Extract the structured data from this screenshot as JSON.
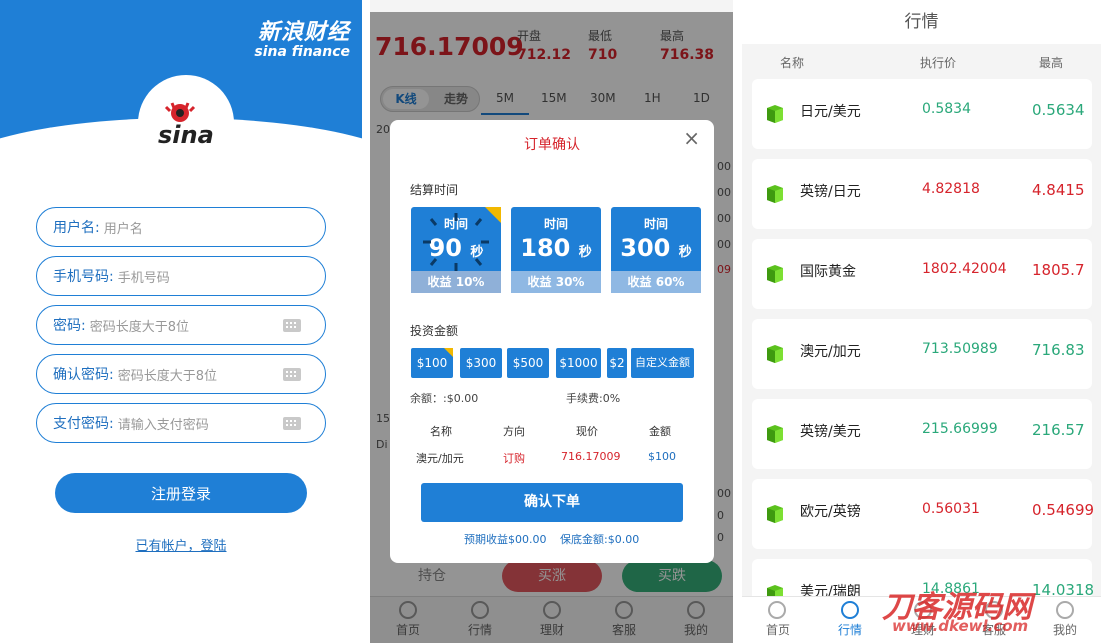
{
  "register": {
    "brand_cn": "新浪财经",
    "brand_en": "sina finance",
    "logo_text": "sina",
    "fields": [
      {
        "label": "用户名:",
        "placeholder": "用户名",
        "keyboard": false
      },
      {
        "label": "手机号码:",
        "placeholder": "手机号码",
        "keyboard": false
      },
      {
        "label": "密码:",
        "placeholder": "密码长度大于8位",
        "keyboard": true
      },
      {
        "label": "确认密码:",
        "placeholder": "密码长度大于8位",
        "keyboard": true
      },
      {
        "label": "支付密码:",
        "placeholder": "请输入支付密码",
        "keyboard": true
      }
    ],
    "submit_label": "注册登录",
    "login_link": "已有帐户，登陆"
  },
  "trade": {
    "price": "716.17009",
    "stats": [
      {
        "label": "开盘",
        "value": "712.12"
      },
      {
        "label": "最低",
        "value": "710"
      },
      {
        "label": "最高",
        "value": "716.38"
      }
    ],
    "chart_tabs": [
      "K线",
      "走势"
    ],
    "timeframes": [
      "5M",
      "15M",
      "30M",
      "1H",
      "1D"
    ],
    "side_numbers": [
      "20",
      "00",
      "00",
      "00",
      "00",
      "09",
      "15",
      "Di",
      "00",
      "0",
      "0"
    ],
    "bottom_buttons": [
      "持仓",
      "买涨",
      "买跌"
    ],
    "tabs": [
      "首页",
      "行情",
      "理财",
      "客服",
      "我的"
    ],
    "modal": {
      "title": "订单确认",
      "close": "×",
      "settle_label": "结算时间",
      "time_cards": [
        {
          "head": "时间",
          "value": "90",
          "unit": "秒",
          "profit": "收益 10%",
          "selected": true
        },
        {
          "head": "时间",
          "value": "180",
          "unit": "秒",
          "profit": "收益 30%",
          "selected": false
        },
        {
          "head": "时间",
          "value": "300",
          "unit": "秒",
          "profit": "收益 60%",
          "selected": false
        }
      ],
      "invest_label": "投资金额",
      "amounts": [
        "$100",
        "$300",
        "$500",
        "$1000",
        "$2",
        "自定义金额"
      ],
      "balance": "余额：:$0.00",
      "fee": "手续费:0%",
      "table_headers": [
        "名称",
        "方向",
        "现价",
        "金额"
      ],
      "table_row": [
        "澳元/加元",
        "订购",
        "716.17009",
        "$100"
      ],
      "confirm_label": "确认下单",
      "expected": "预期收益$00.00",
      "margin": "保底金额:$0.00"
    }
  },
  "market": {
    "title": "行情",
    "columns": [
      "名称",
      "执行价",
      "最高"
    ],
    "rows": [
      {
        "name": "日元/美元",
        "price": "0.5834",
        "high": "0.5634",
        "price_color": "green",
        "high_color": "green"
      },
      {
        "name": "英镑/日元",
        "price": "4.82818",
        "high": "4.8415",
        "price_color": "red",
        "high_color": "red"
      },
      {
        "name": "国际黄金",
        "price": "1802.42004",
        "high": "1805.7",
        "price_color": "red",
        "high_color": "red"
      },
      {
        "name": "澳元/加元",
        "price": "713.50989",
        "high": "716.83",
        "price_color": "green",
        "high_color": "green"
      },
      {
        "name": "英镑/美元",
        "price": "215.66999",
        "high": "216.57",
        "price_color": "green",
        "high_color": "green"
      },
      {
        "name": "欧元/英镑",
        "price": "0.56031",
        "high": "0.54699",
        "price_color": "red",
        "high_color": "red"
      },
      {
        "name": "美元/瑞朗",
        "price": "14.8861",
        "high": "14.0318",
        "price_color": "green",
        "high_color": "green"
      }
    ],
    "tabs": [
      "首页",
      "行情",
      "理财",
      "客服",
      "我的"
    ],
    "watermark": "刀客源码网",
    "watermark_url": "www.dkewl.com"
  },
  "colors": {
    "primary": "#1f7fd6",
    "red": "#d6242c",
    "green": "#2aa87a",
    "gold": "#f2b800"
  }
}
